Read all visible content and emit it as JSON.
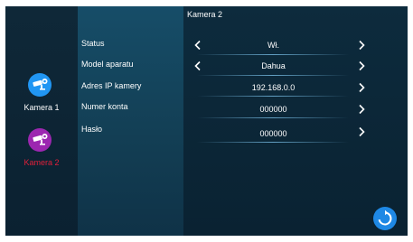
{
  "header": {
    "title": "Kamera 2"
  },
  "cameras": [
    {
      "label": "Kamera 1",
      "icon": "security-camera-icon",
      "color": "#2196f3",
      "active": false
    },
    {
      "label": "Kamera 2",
      "icon": "security-camera-icon",
      "color": "#9c27b0",
      "active": true
    }
  ],
  "fields": {
    "status": {
      "label": "Status",
      "value": "Wł."
    },
    "model": {
      "label": "Model aparatu",
      "value": "Dahua"
    },
    "ip": {
      "label": "Adres IP kamery",
      "value": "192.168.0.0"
    },
    "account": {
      "label": "Numer konta",
      "value": "000000"
    },
    "password": {
      "label": "Hasło",
      "value": "000000"
    }
  },
  "icons": {
    "prev": "chevron-left-icon",
    "next": "chevron-right-icon",
    "refresh": "refresh-icon"
  },
  "colors": {
    "active_label": "#e0203a",
    "refresh_button": "#1e88e5"
  }
}
